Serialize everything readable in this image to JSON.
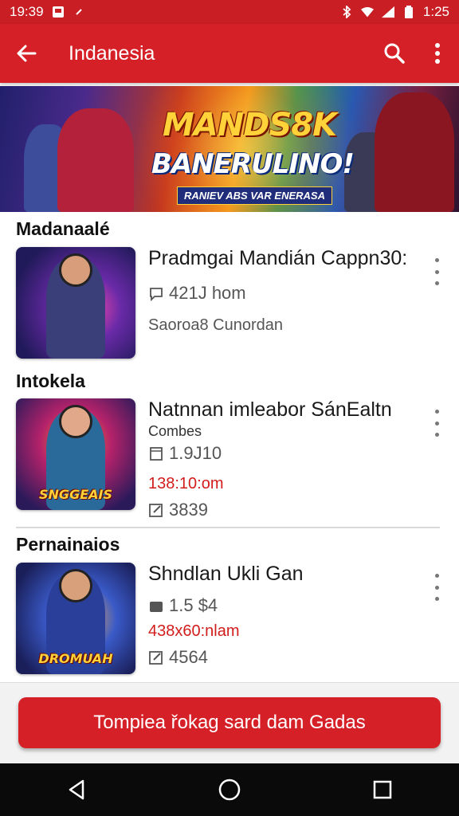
{
  "status_bar": {
    "time_left": "19:39",
    "time_right": "1:25",
    "icons": [
      "notification-icon",
      "dot-icon",
      "bluetooth-icon",
      "wifi-icon",
      "signal-icon",
      "battery-icon"
    ]
  },
  "app_bar": {
    "title": "Indanesia",
    "icons": [
      "back-arrow-icon",
      "search-icon",
      "more-vert-icon"
    ]
  },
  "banner": {
    "line1": "MANDS8K",
    "line2": "BANERULINO!",
    "line3": "RANIEV ABS VAR ENERASA"
  },
  "sections": [
    {
      "heading": "Madanaalé",
      "item": {
        "name": "Pradmgai Mandián Cappn30:",
        "sub": "",
        "row1": "421J hom",
        "row1_icon": "chat-icon",
        "row2": "Saoroa8 Cunordan",
        "row2_red": false,
        "row3": "",
        "thumb_logo": ""
      }
    },
    {
      "heading": "Intokela",
      "item": {
        "name": "Natnnan imleabor SánEaltn",
        "sub": "Combes",
        "row1": "1.9J10",
        "row1_icon": "calendar-icon",
        "row2": "138:10:om",
        "row2_red": true,
        "row3": "3839",
        "row3_icon": "edit-icon",
        "thumb_logo": "SNGGEAIS"
      }
    },
    {
      "heading": "Pernainaios",
      "item": {
        "name": "Shndlan Ukli       Gan",
        "sub": "",
        "row1": "1.5 $4",
        "row1_icon": "wallet-icon",
        "row2": "438x60:nlam",
        "row2_red": true,
        "row3": "4564",
        "row3_icon": "edit-icon",
        "thumb_logo": "DROMUAH"
      }
    }
  ],
  "cta": {
    "label": "Tompiea řokag sard dam Gadas"
  },
  "colors": {
    "primary": "#d62027",
    "status_bar": "#c81e24",
    "red_text": "#d21c1c"
  }
}
